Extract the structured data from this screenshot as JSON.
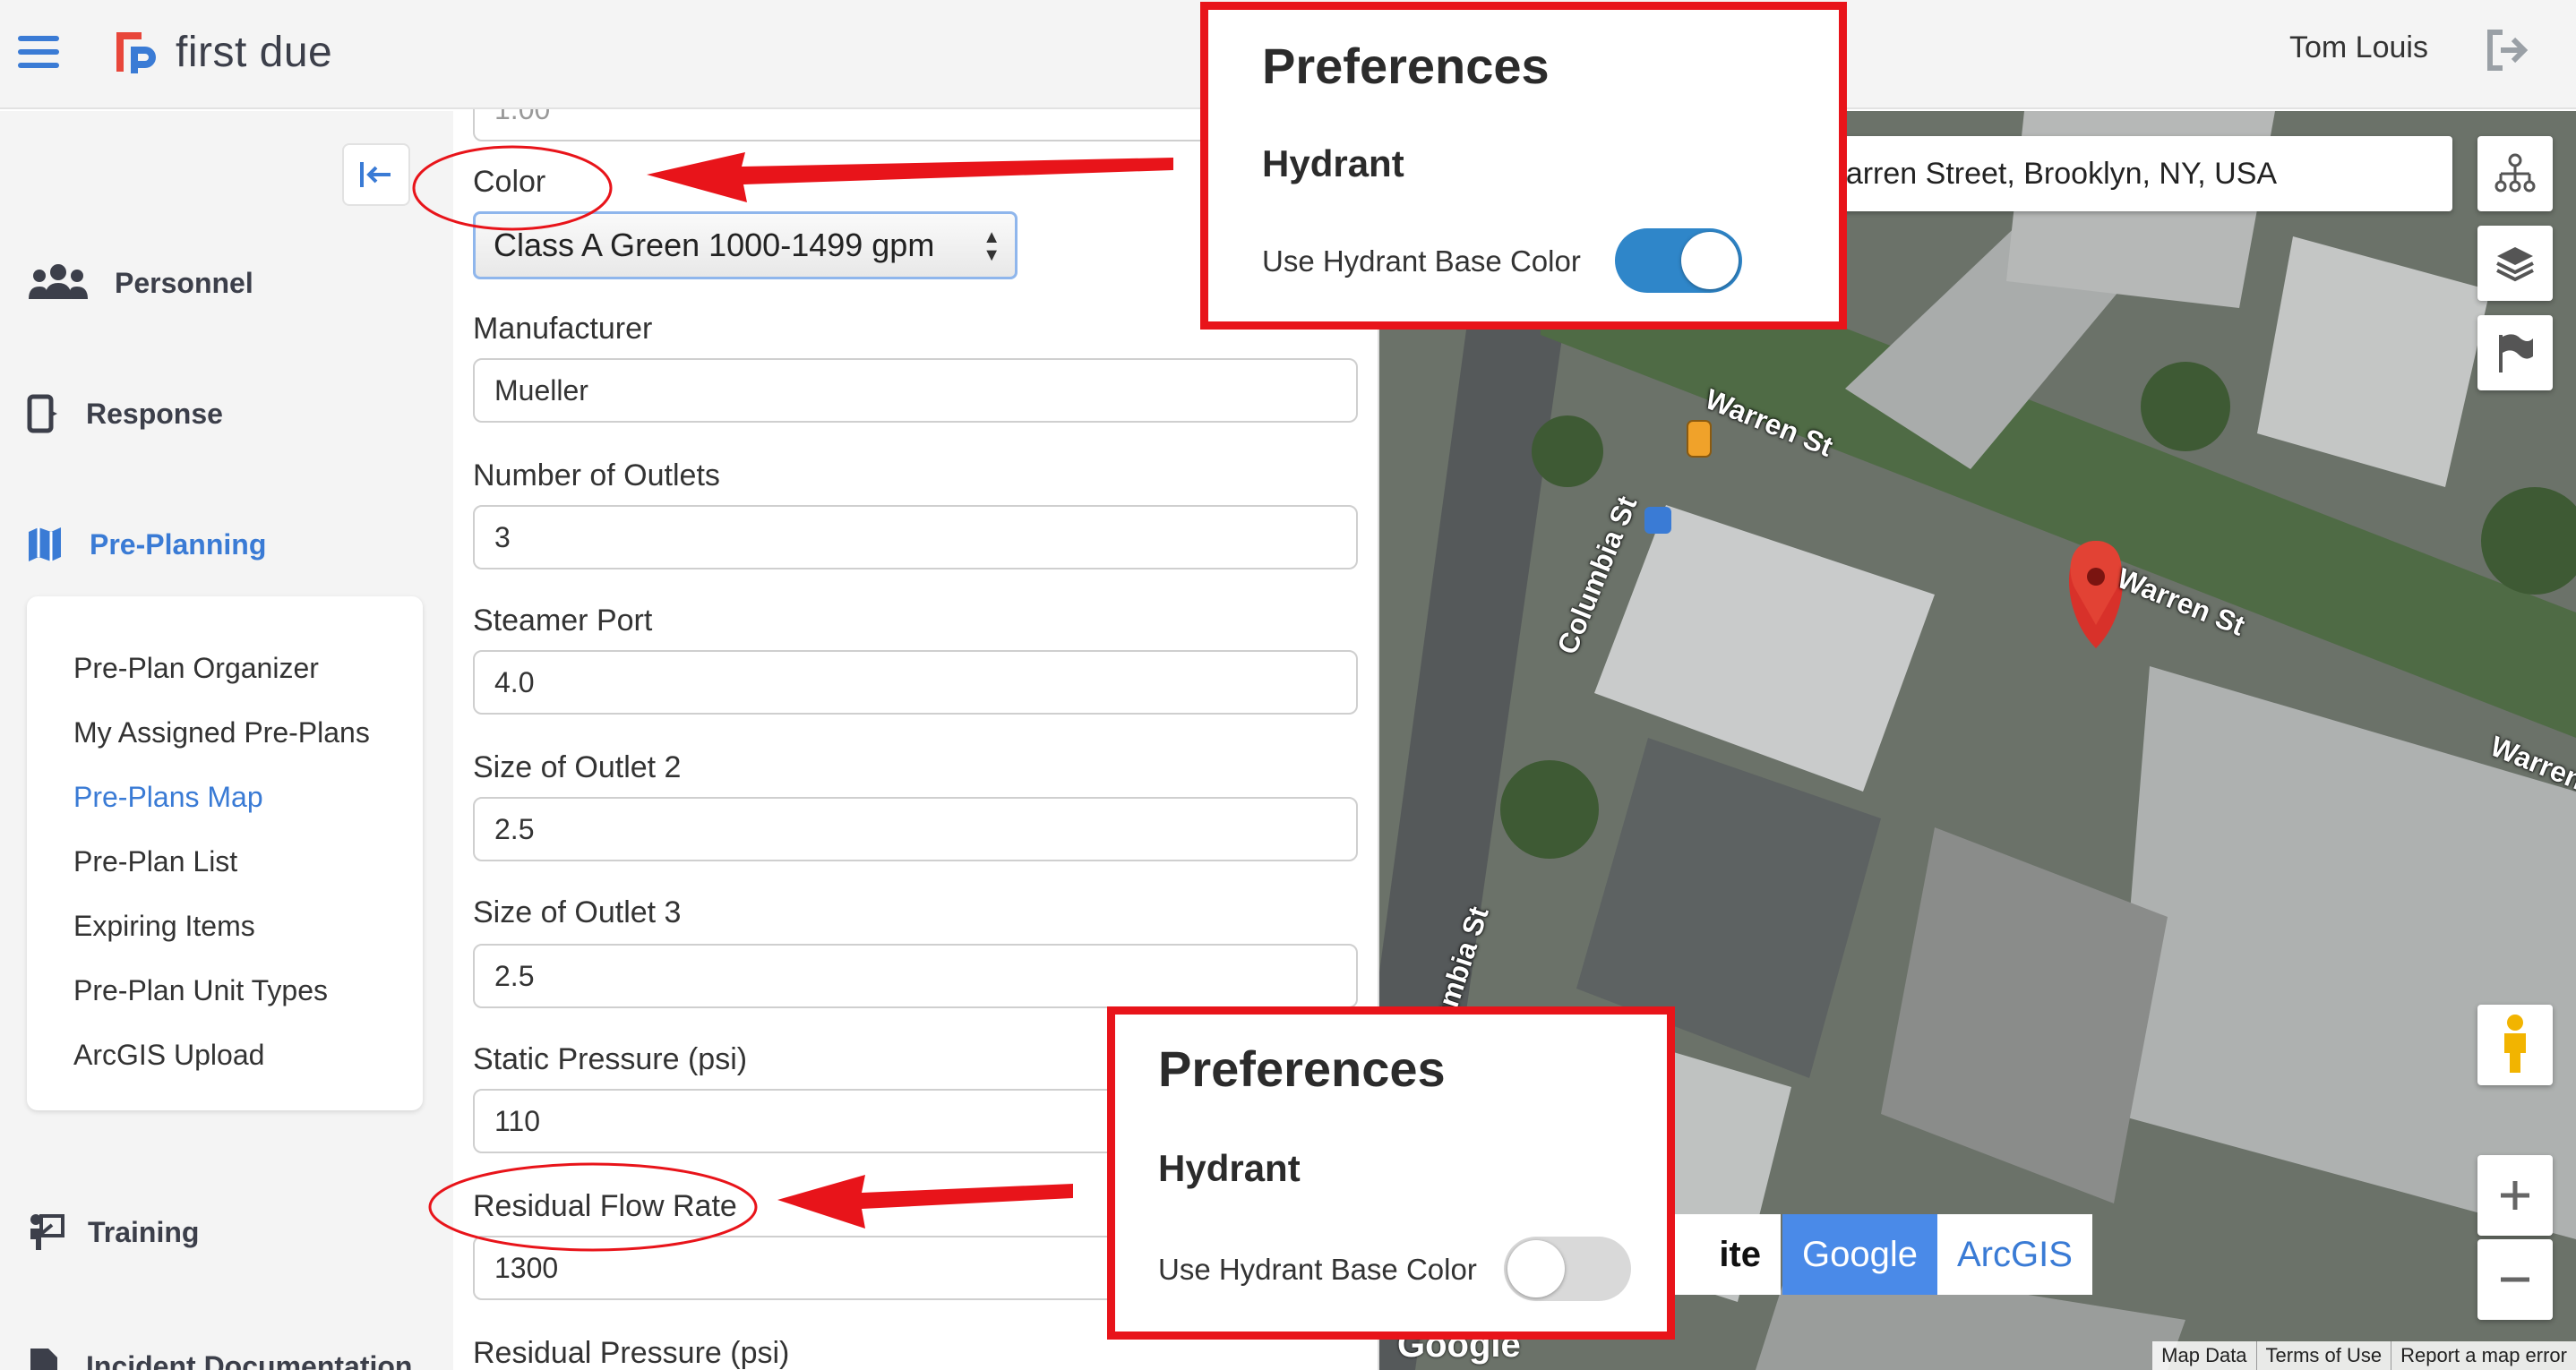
{
  "header": {
    "logo_text": "first due",
    "user_name": "Tom Louis"
  },
  "sidebar": {
    "nav": [
      {
        "label": "Personnel"
      },
      {
        "label": "Response"
      },
      {
        "label": "Pre-Planning"
      },
      {
        "label": "Training"
      },
      {
        "label": "Incident Documentation"
      }
    ],
    "submenu": [
      "Pre-Plan Organizer",
      "My Assigned Pre-Plans",
      "Pre-Plans Map",
      "Pre-Plan List",
      "Expiring Items",
      "Pre-Plan Unit Types",
      "ArcGIS Upload"
    ],
    "active_submenu": "Pre-Plans Map"
  },
  "form": {
    "top_partial_value": "1.00",
    "color_label": "Color",
    "color_value": "Class A Green 1000-1499 gpm",
    "manufacturer_label": "Manufacturer",
    "manufacturer_value": "Mueller",
    "outlets_label": "Number of Outlets",
    "outlets_value": "3",
    "steamer_label": "Steamer Port",
    "steamer_value": "4.0",
    "outlet2_label": "Size of Outlet 2",
    "outlet2_value": "2.5",
    "outlet3_label": "Size of Outlet 3",
    "outlet3_value": "2.5",
    "static_label": "Static Pressure (psi)",
    "static_value": "110",
    "residual_flow_label": "Residual Flow Rate",
    "residual_flow_value": "1300",
    "residual_pressure_label": "Residual Pressure (psi)"
  },
  "map": {
    "search_value": "Warren Street, Brooklyn, NY, USA",
    "streets": [
      "Warren St",
      "Warren St",
      "Warren",
      "Columbia St",
      "Columbia St"
    ],
    "satellite_partial": "ite",
    "source_options": [
      "Google",
      "ArcGIS"
    ],
    "active_source": "Google",
    "google_watermark": "Google",
    "footer": [
      "Map Data",
      "Terms of Use",
      "Report a map error"
    ]
  },
  "callout_on": {
    "title": "Preferences",
    "section": "Hydrant",
    "toggle_label": "Use Hydrant Base Color",
    "toggle_on": true
  },
  "callout_off": {
    "title": "Preferences",
    "section": "Hydrant",
    "toggle_label": "Use Hydrant Base Color",
    "toggle_on": false
  },
  "colors": {
    "accent": "#3a7bd5",
    "annotation_red": "#e8141a",
    "toggle_on": "#2f86c9",
    "toggle_off": "#d9d9d9"
  }
}
